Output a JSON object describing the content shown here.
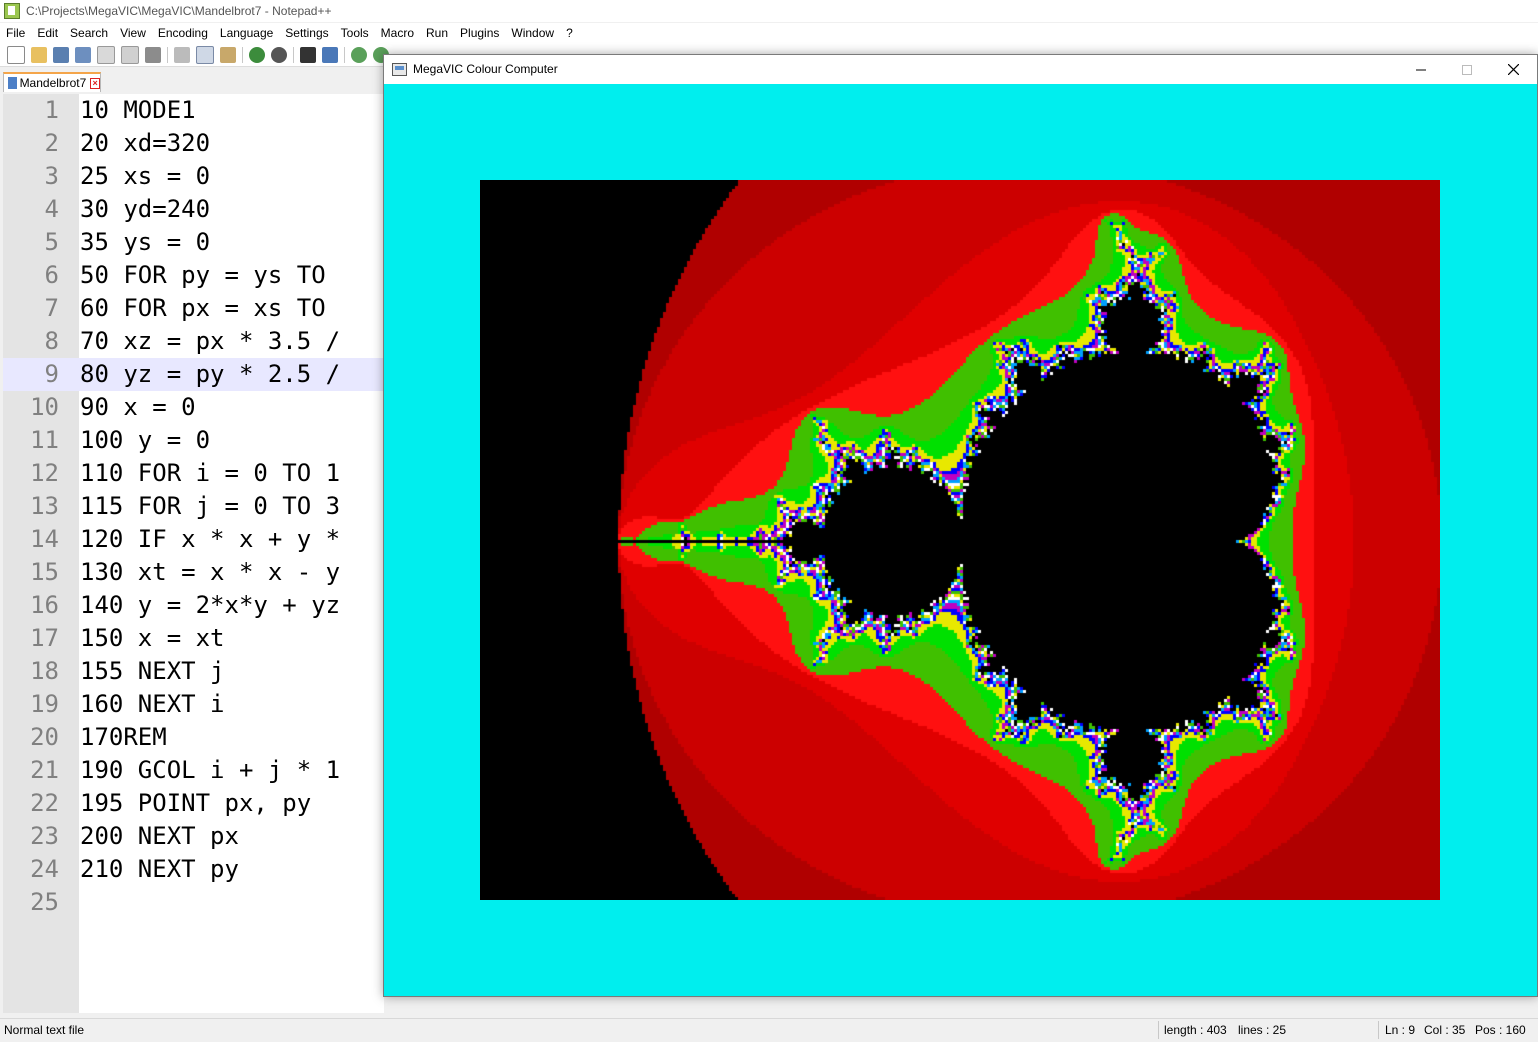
{
  "notepad": {
    "title": "C:\\Projects\\MegaVIC\\MegaVIC\\Mandelbrot7 - Notepad++",
    "menu": [
      "File",
      "Edit",
      "Search",
      "View",
      "Encoding",
      "Language",
      "Settings",
      "Tools",
      "Macro",
      "Run",
      "Plugins",
      "Window",
      "?"
    ],
    "tab_label": "Mandelbrot7",
    "current_line": 9,
    "lines": [
      "10 MODE1",
      "20 xd=320",
      "25 xs = 0",
      "30 yd=240",
      "35 ys = 0",
      "50 FOR py = ys TO",
      "60 FOR px = xs TO",
      "70 xz = px * 3.5 /",
      "80 yz = py * 2.5 /",
      "90 x = 0",
      "100 y = 0",
      "110 FOR i = 0 TO 1",
      "115 FOR j = 0 TO 3",
      "120 IF x * x + y *",
      "130 xt = x * x - y",
      "140 y = 2*x*y + yz",
      "150 x = xt",
      "155 NEXT j",
      "160 NEXT i",
      "170REM",
      "190 GCOL i + j * 1",
      "195 POINT px, py",
      "200 NEXT px",
      "210 NEXT py",
      ""
    ],
    "status": {
      "file_type": "Normal text file",
      "length": "length : 403",
      "lines": "lines : 25",
      "ln": "Ln : 9",
      "col": "Col : 35",
      "pos": "Pos : 160"
    }
  },
  "megavic": {
    "title": "MegaVIC Colour Computer",
    "background_color": "#00eeee",
    "fractal_colors": [
      "#b00000",
      "#cc0000",
      "#e00000",
      "#ff1010",
      "#40c000",
      "#00e000",
      "#e8e800",
      "#0000ff",
      "#c000c0",
      "#00a0ff",
      "#ffffff",
      "#000000"
    ]
  },
  "icons": {
    "minimize": "minimize-icon",
    "maximize": "maximize-icon",
    "close": "close-icon"
  }
}
